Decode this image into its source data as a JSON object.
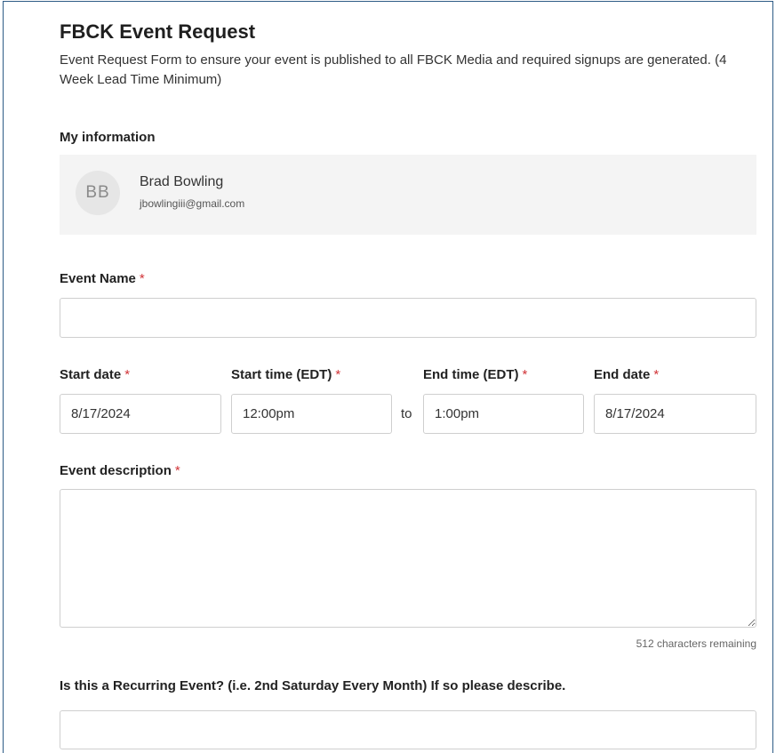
{
  "form": {
    "title": "FBCK Event Request",
    "subtitle": "Event Request Form to ensure your event is published to all FBCK Media and required signups are generated. (4 Week Lead Time Minimum)"
  },
  "my_info": {
    "label": "My information",
    "initials": "BB",
    "name": "Brad Bowling",
    "email": "jbowlingiii@gmail.com"
  },
  "required_marker": "*",
  "event_name": {
    "label": "Event Name",
    "value": ""
  },
  "start_date": {
    "label": "Start date",
    "value": "8/17/2024"
  },
  "start_time": {
    "label": "Start time (EDT)",
    "value": "12:00pm"
  },
  "range_separator": "to",
  "end_time": {
    "label": "End time (EDT)",
    "value": "1:00pm"
  },
  "end_date": {
    "label": "End date",
    "value": "8/17/2024"
  },
  "description": {
    "label": "Event description",
    "value": "",
    "counter": "512 characters remaining"
  },
  "recurring": {
    "label": "Is this a Recurring Event? (i.e. 2nd Saturday Every Month) If so please describe.",
    "value": ""
  }
}
